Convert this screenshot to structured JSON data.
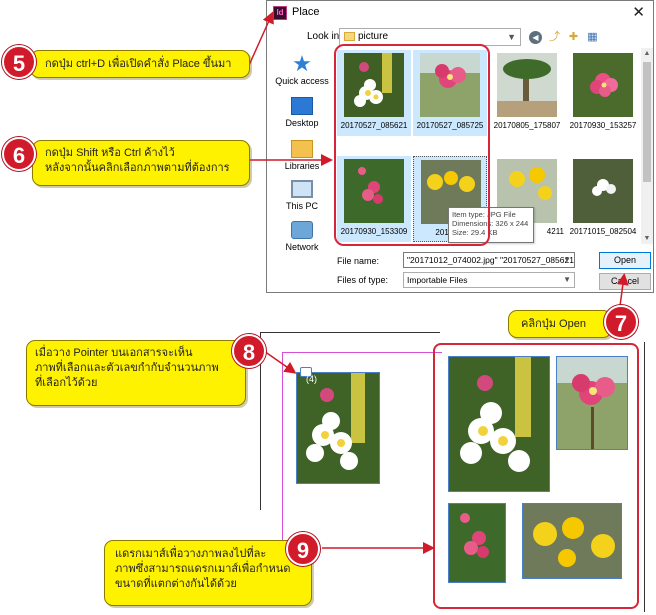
{
  "dialog": {
    "title": "Place",
    "app_icon_text": "Id",
    "close_glyph": "✕",
    "look_in_label": "Look in:",
    "look_in_value": "picture",
    "places": [
      {
        "label": "Quick access",
        "icon": "star-icon"
      },
      {
        "label": "Desktop",
        "icon": "desktop-icon"
      },
      {
        "label": "Libraries",
        "icon": "libraries-icon"
      },
      {
        "label": "This PC",
        "icon": "computer-icon"
      },
      {
        "label": "Network",
        "icon": "network-icon"
      }
    ],
    "files": [
      {
        "name": "20170527_085621",
        "selected": true
      },
      {
        "name": "20170527_085725",
        "selected": true
      },
      {
        "name": "20170805_175807",
        "selected": false
      },
      {
        "name": "20170930_153257",
        "selected": false
      },
      {
        "name": "20170930_153309",
        "selected": true
      },
      {
        "name": "20171012_074002",
        "selected": true,
        "display": "2017101"
      },
      {
        "name": "20171012_074211",
        "selected": false,
        "display": "4211"
      },
      {
        "name": "20171015_082504",
        "selected": false
      }
    ],
    "tooltip": {
      "line1": "Item type: JPG File",
      "line2": "Dimensions: 326 x 244",
      "line3": "Size: 29.4 KB"
    },
    "file_name_label": "File name:",
    "file_name_value": "\"20171012_074002.jpg\" \"20170527_085621.jp",
    "file_type_label": "Files of type:",
    "file_type_value": "Importable Files",
    "open_label": "Open",
    "cancel_label": "Cancel"
  },
  "callouts": {
    "step5": {
      "num": "5",
      "text": "กดปุ่ม ctrl+D เพื่อเปิดคำสั่ง Place ขึ้นมา"
    },
    "step6": {
      "num": "6",
      "line1": "กดปุ่ม Shift หรือ Ctrl ค้างไว้",
      "line2": "หลังจากนั้นคลิกเลือกภาพตามที่ต้องการ"
    },
    "step7": {
      "num": "7",
      "text": "คลิกปุ่ม Open"
    },
    "step8": {
      "num": "8",
      "line1": "เมื่อวาง Pointer บนเอกสารจะเห็น",
      "line2": "ภาพที่เลือกและตัวเลขกำกับจำนวนภาพ",
      "line3": "ที่เลือกไว้ด้วย"
    },
    "step9": {
      "num": "9",
      "line1": "แดรกเมาส์เพื่อวางภาพลงไปที่ละ",
      "line2": "ภาพซึ่งสามารถแดรกเมาส์เพื่อกำหนด",
      "line3": "ขนาดที่แตกต่างกันได้ด้วย"
    }
  },
  "canvas": {
    "cursor_count": "(4)"
  },
  "colors": {
    "callout_fill": "#fff200",
    "badge_red": "#d11a2a",
    "frame_red": "#d6263a",
    "margin_guide": "#d64fd6",
    "frame_blue": "#4a80c8",
    "selection_blue": "#cce8ff"
  }
}
